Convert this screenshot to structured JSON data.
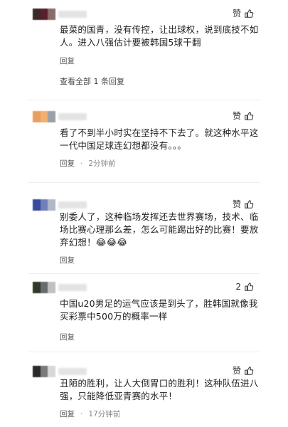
{
  "comments": [
    {
      "like_label": "赞",
      "text": "最菜的国青，没有传控，让出球权，说到底技不如人。进入八强估计要被韩国5球干翻",
      "reply_label": "回复",
      "time": "",
      "view_replies": "查看全部 1 条回复",
      "avatar_colors": [
        "#3a2a2a",
        "#5a1f2a",
        "#8a6a6a"
      ]
    },
    {
      "like_label": "赞",
      "text": "看了不到半小时实在坚持不下去了。就这种水平这一代中国足球连幻想都没有。。。",
      "reply_label": "回复",
      "time": "2分钟前",
      "avatar_colors": [
        "#e8a060",
        "#f0b070",
        "#9aa0a8"
      ]
    },
    {
      "like_label": "赞",
      "text": "别委人了，这种临场发挥还去世界赛场，技术、临场比赛心理那么差，怎么可能踢出好的比赛！要放弃幻想！😂😂😂",
      "reply_label": "回复",
      "time": "",
      "avatar_colors": [
        "#3a4aa0",
        "#7080b8",
        "#b0b8c8"
      ]
    },
    {
      "like_label": "2",
      "text": "中国u20男足的运气应该是到头了，胜韩国就像我买彩票中500万的概率一样",
      "reply_label": "回复",
      "time": "",
      "avatar_colors": [
        "#2f3a2a",
        "#6a6a6a",
        "#c0c0c0"
      ]
    },
    {
      "like_label": "赞",
      "text": "丑陋的胜利，让人大倒胃口的胜利！这种队伍进八强，只能降低亚青赛的水平！",
      "reply_label": "回复",
      "time": "17分钟前",
      "avatar_colors": [
        "#2a2a2a",
        "#7a7a7a",
        "#d8d8d8"
      ]
    }
  ],
  "colors": {
    "text": "#1f1f1f",
    "meta": "#555555",
    "divider": "#eeeeee"
  },
  "icons": {
    "like": "thumbs-up-icon"
  }
}
